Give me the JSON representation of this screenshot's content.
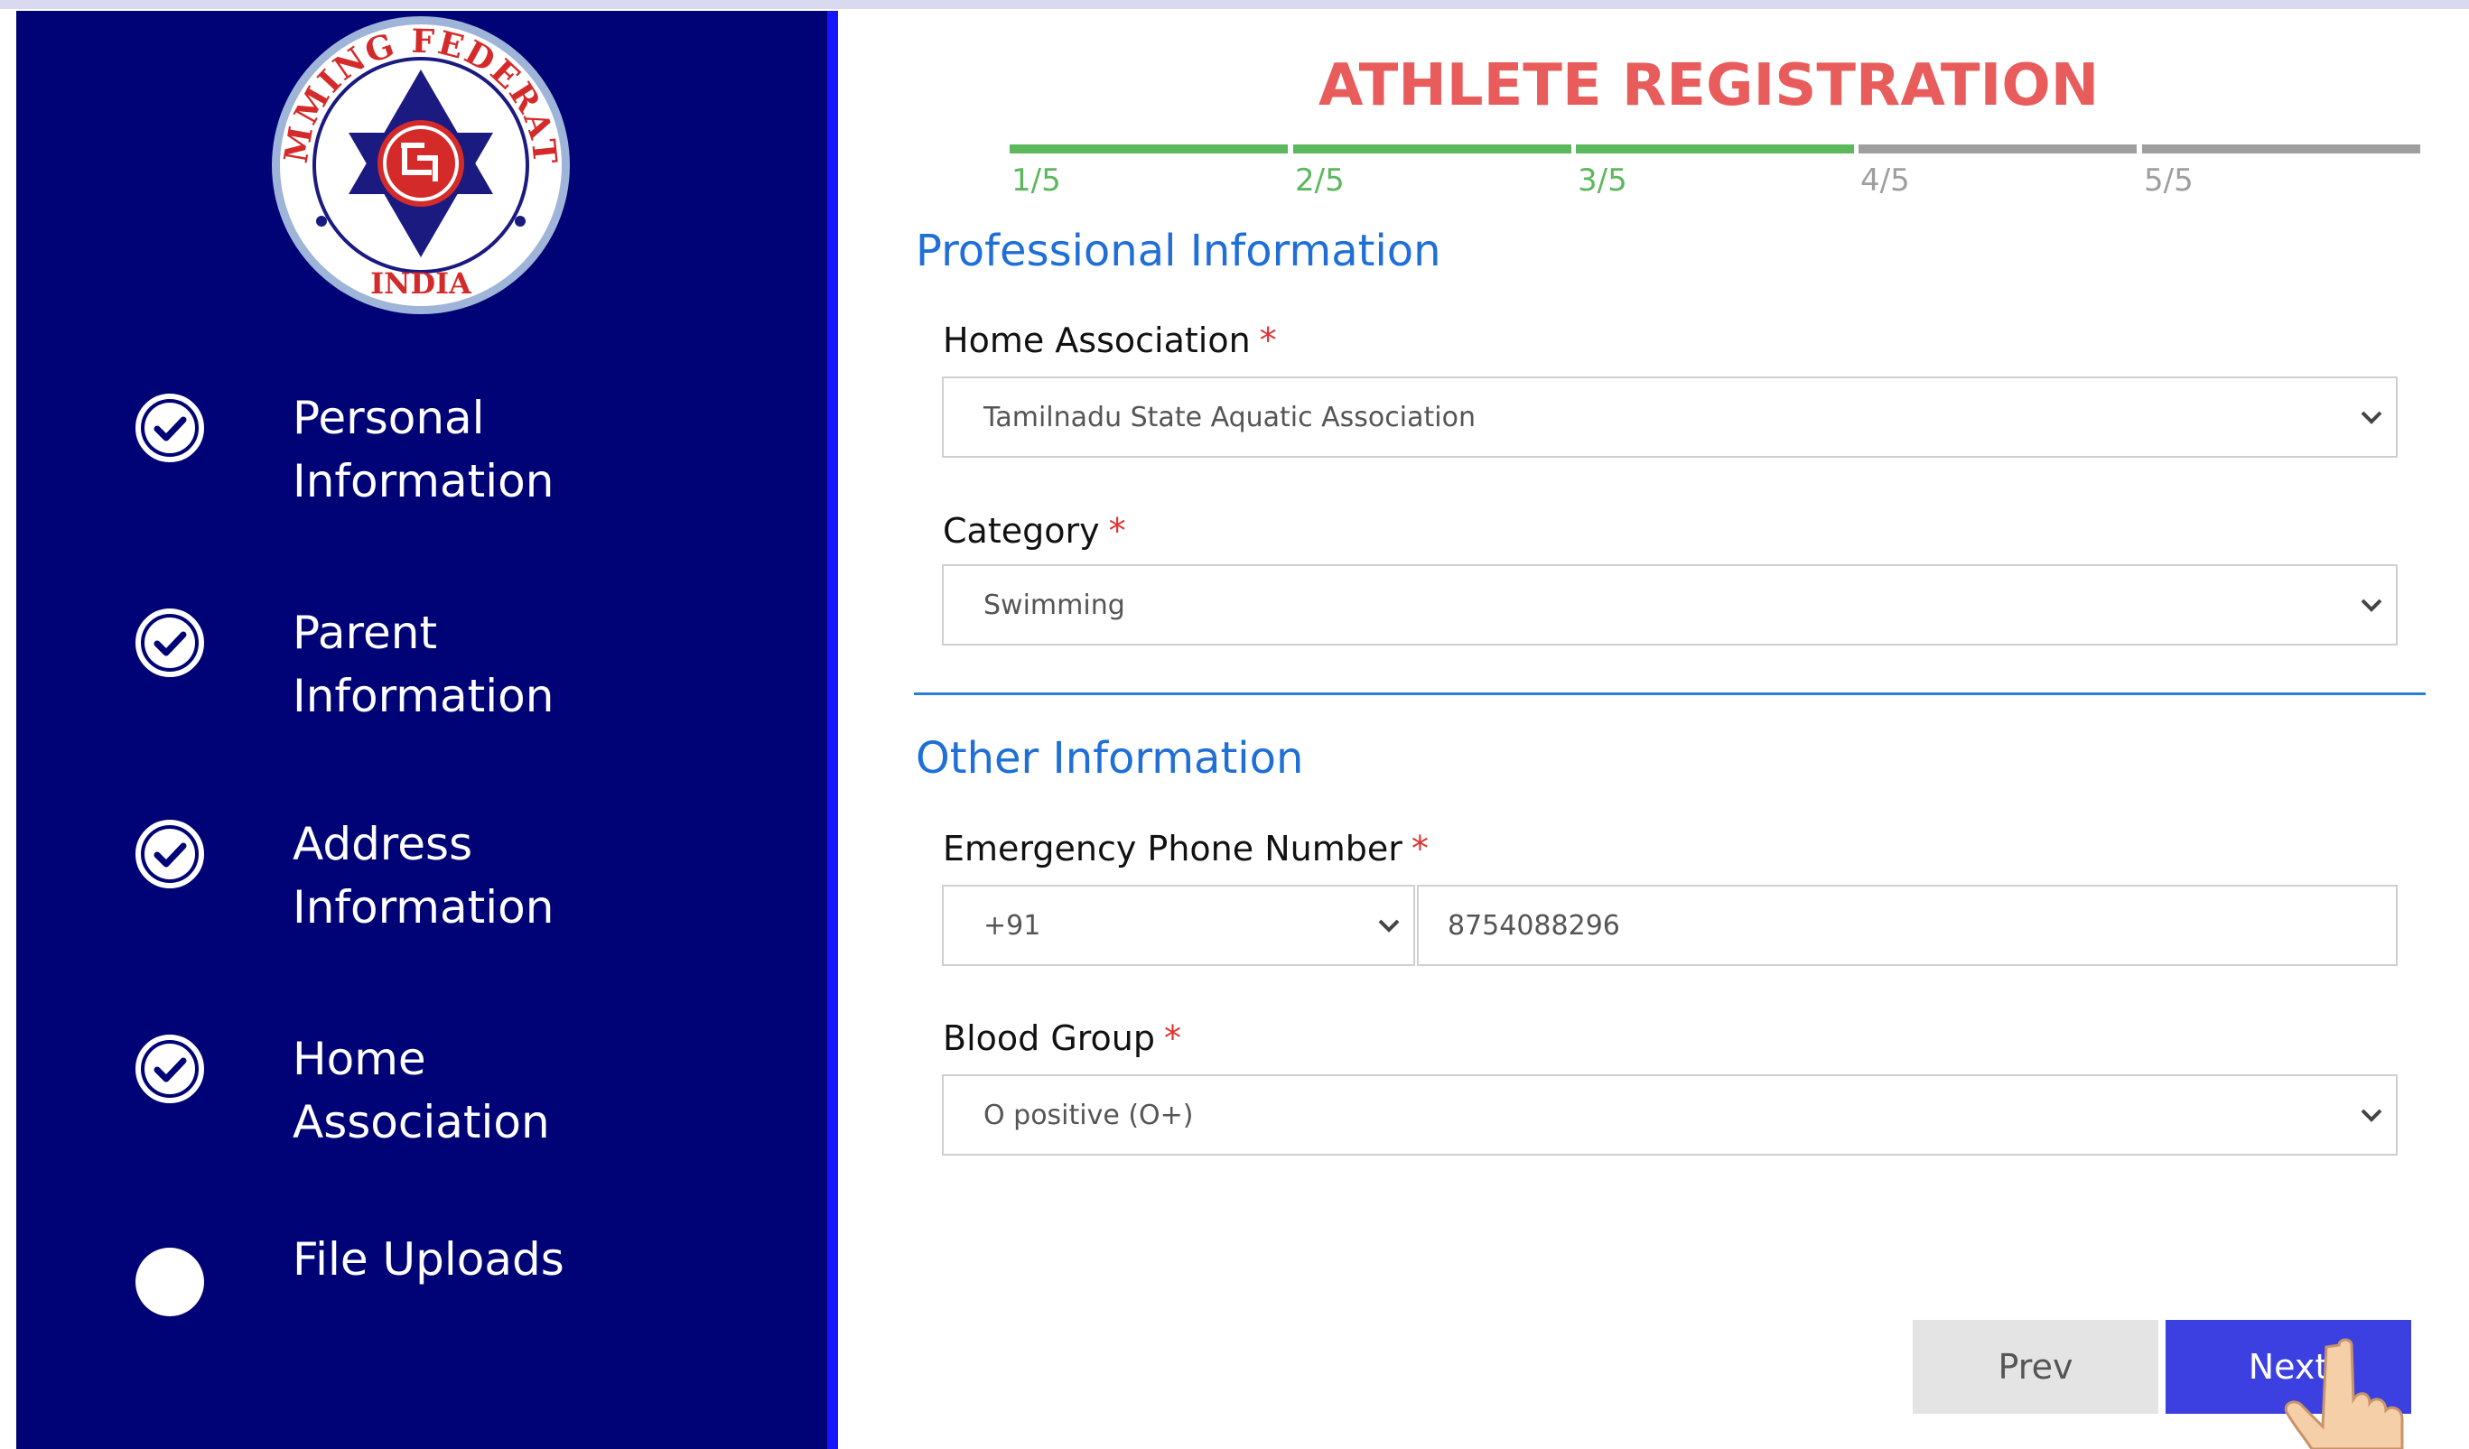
{
  "logo": {
    "text_top": "SWIMMING FEDERATION",
    "text_bottom": "INDIA"
  },
  "sidebar": {
    "steps": [
      {
        "label": "Personal Information",
        "done": true
      },
      {
        "label": "Parent Information",
        "done": true
      },
      {
        "label": "Address Information",
        "done": true
      },
      {
        "label": "Home Association",
        "done": true
      },
      {
        "label": "File Uploads",
        "done": false
      }
    ]
  },
  "header": {
    "title": "ATHLETE REGISTRATION"
  },
  "progress": {
    "steps": [
      "1/5",
      "2/5",
      "3/5",
      "4/5",
      "5/5"
    ],
    "completed": 3,
    "colors": {
      "done": "#5cb85c",
      "pending": "#9e9e9e"
    }
  },
  "professional": {
    "title": "Professional Information",
    "home_association": {
      "label": "Home Association",
      "required_mark": "*",
      "value": "Tamilnadu State Aquatic Association"
    },
    "category": {
      "label": "Category",
      "required_mark": "*",
      "value": "Swimming"
    }
  },
  "other": {
    "title": "Other Information",
    "emergency_phone": {
      "label": "Emergency Phone Number",
      "required_mark": "*",
      "country_code": "+91",
      "number": "8754088296"
    },
    "blood_group": {
      "label": "Blood Group",
      "required_mark": "*",
      "value": "O positive (O+)"
    }
  },
  "actions": {
    "prev_label": "Prev",
    "next_label": "Next"
  },
  "colors": {
    "sidebar": "#000375",
    "accent": "#3c40e0",
    "title": "#e85c5c",
    "section": "#1f6fd6"
  }
}
